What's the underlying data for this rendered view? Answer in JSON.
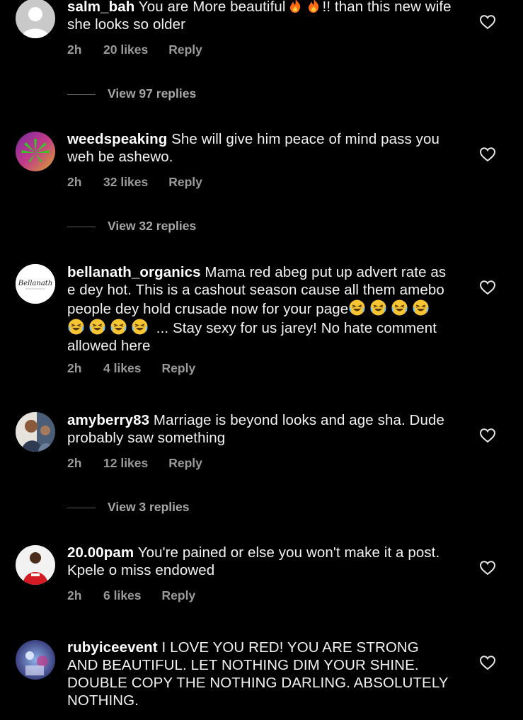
{
  "colors": {
    "background": "#000000",
    "text": "#f2f2f2",
    "meta": "#9a9a9a",
    "fire": "#ff7a1a",
    "emoji_face": "#f7c531"
  },
  "comments": [
    {
      "username": "salm_bah",
      "text_before": " You are More beautiful",
      "emoji_icons": [
        "fire-emoji",
        "fire-emoji"
      ],
      "text_after": "!! than this new wife she looks so older",
      "time": "2h",
      "likes": "20 likes",
      "reply_label": "Reply",
      "view_replies": "View 97 replies"
    },
    {
      "username": "weedspeaking",
      "text": " She will give him peace of mind pass you weh be ashewo.",
      "time": "2h",
      "likes": "32 likes",
      "reply_label": "Reply",
      "view_replies": "View 32 replies"
    },
    {
      "username": "bellanath_organics",
      "text_before": " Mama red abeg put up advert rate as e dey hot. This is a cashout season cause all them amebo people dey hold crusade now for your page",
      "emoji_icons": [
        "laughing-emoji",
        "laughing-emoji",
        "laughing-emoji",
        "laughing-emoji",
        "laughing-emoji",
        "laughing-emoji",
        "laughing-emoji",
        "laughing-emoji"
      ],
      "text_after": " ... Stay sexy for us jarey! No hate comment allowed here",
      "avatar_text": "Bellanath",
      "time": "2h",
      "likes": "4 likes",
      "reply_label": "Reply"
    },
    {
      "username": "amyberry83",
      "text": " Marriage is beyond looks and age sha. Dude probably saw something",
      "time": "2h",
      "likes": "12 likes",
      "reply_label": "Reply",
      "view_replies": "View 3 replies"
    },
    {
      "username": "20.00pam",
      "text": " You're pained or else you won't make it a post. Kpele o miss endowed",
      "time": "2h",
      "likes": "6 likes",
      "reply_label": "Reply"
    },
    {
      "username": "rubyiceevent",
      "text": " I LOVE YOU RED! YOU ARE STRONG AND BEAUTIFUL. LET NOTHING DIM YOUR SHINE. DOUBLE COPY THE NOTHING DARLING. ABSOLUTELY NOTHING."
    }
  ],
  "icons": {
    "like": "heart-outline-icon"
  }
}
